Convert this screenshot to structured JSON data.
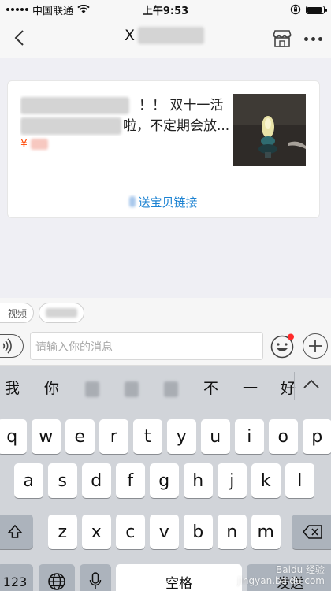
{
  "status_bar": {
    "carrier": "中国联通",
    "time": "上午9:53",
    "battery_level": 0.9
  },
  "nav": {
    "title_prefix": "X"
  },
  "card": {
    "line1_suffix": "！！ 双十一活",
    "line2_suffix": "啦，不定期会放...",
    "price_symbol": "¥",
    "send_link": "送宝贝链接"
  },
  "quick": {
    "chip1": "视频"
  },
  "input": {
    "placeholder": "请输入你的消息"
  },
  "keyboard": {
    "candidates": [
      "我",
      "你",
      "不",
      "一",
      "好"
    ],
    "row1": [
      "q",
      "w",
      "e",
      "r",
      "t",
      "y",
      "u",
      "i",
      "o",
      "p"
    ],
    "row2": [
      "a",
      "s",
      "d",
      "f",
      "g",
      "h",
      "j",
      "k",
      "l"
    ],
    "row3": [
      "z",
      "x",
      "c",
      "v",
      "b",
      "n",
      "m"
    ],
    "num_label": "123",
    "space_label": "空格",
    "send_label": "发送"
  },
  "watermark": {
    "brand": "Baidu 经验",
    "url": "jingyan.baidu.com"
  },
  "colors": {
    "link_blue": "#1b82d2",
    "price_orange": "#ff4400",
    "notify_red": "#ff2a2a"
  }
}
